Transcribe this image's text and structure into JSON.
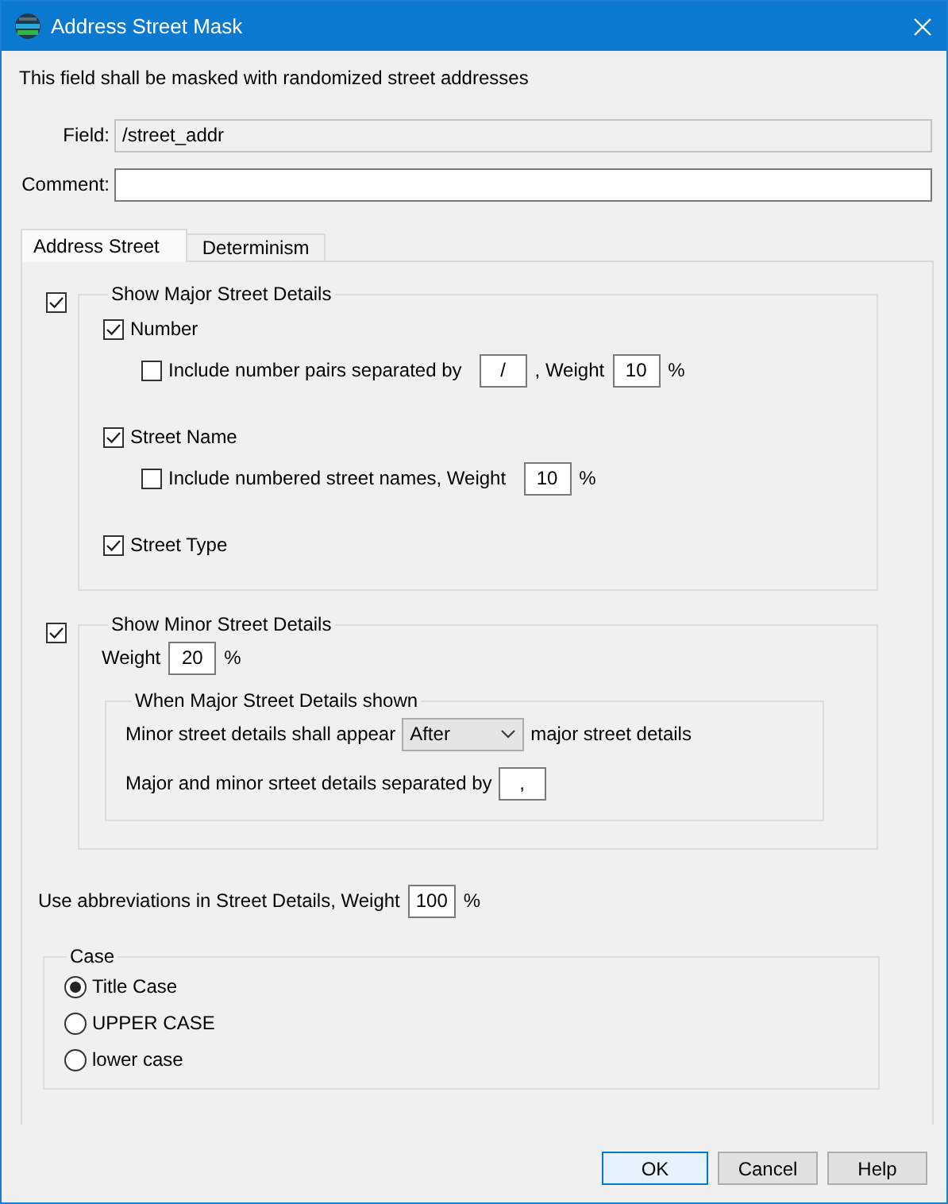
{
  "window": {
    "title": "Address Street Mask"
  },
  "description": "This field shall be masked with randomized street addresses",
  "field": {
    "label": "Field:",
    "value": "/street_addr",
    "disabled": true
  },
  "comment": {
    "label": "Comment:",
    "disabled": false
  },
  "tabs": [
    {
      "label": "Address Street",
      "selected": true
    },
    {
      "label": "Determinism",
      "selected": false
    }
  ],
  "major": {
    "label": "Show Major Street Details",
    "checked": true,
    "options": [
      {
        "label": "Number",
        "checked": true,
        "detail": {
          "label": "Include number pairs separated by",
          "checked": false,
          "parts": [
            {
              "kind": "input",
              "value": "/"
            },
            {
              "kind": "label",
              "text": ", Weight"
            },
            {
              "kind": "input",
              "value": "10"
            },
            {
              "kind": "label",
              "text": "%"
            }
          ]
        }
      },
      {
        "label": "Street Name",
        "checked": true,
        "detail": {
          "label": "Include numbered street names, Weight",
          "checked": false,
          "parts": [
            {
              "kind": "input",
              "value": "10"
            },
            {
              "kind": "label",
              "text": "%"
            }
          ]
        }
      },
      {
        "label": "Street Type",
        "checked": true
      }
    ]
  },
  "minor": {
    "label": "Show Minor Street Details",
    "checked": true,
    "weight": [
      {
        "kind": "label",
        "text": "Weight"
      },
      {
        "kind": "input",
        "value": "20"
      },
      {
        "kind": "label",
        "text": "%"
      }
    ],
    "group": {
      "title": "When Major Street Details shown",
      "rows": [
        {
          "label": "Minor street details shall appear",
          "control": {
            "kind": "dropdown",
            "value": "After"
          },
          "suffix": "major street details"
        },
        {
          "label": "Major and minor srteet details separated by",
          "control": {
            "kind": "input",
            "value": ","
          }
        }
      ]
    }
  },
  "abbreviations": [
    {
      "kind": "label",
      "text": "Use abbreviations in Street Details, Weight"
    },
    {
      "kind": "input",
      "value": "100"
    },
    {
      "kind": "label",
      "text": "%"
    }
  ],
  "case": {
    "title": "Case",
    "options": [
      {
        "label": "Title Case",
        "selected": true
      },
      {
        "label": "UPPER CASE",
        "selected": false
      },
      {
        "label": "lower case",
        "selected": false
      }
    ]
  },
  "buttons": [
    {
      "label": "OK",
      "default": true
    },
    {
      "label": "Cancel",
      "default": false
    },
    {
      "label": "Help",
      "default": false
    }
  ]
}
